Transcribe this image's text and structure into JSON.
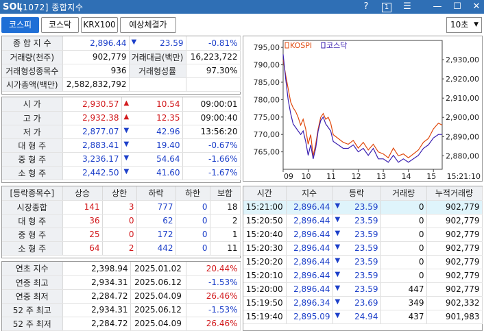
{
  "window": {
    "logo": "SOL",
    "title": "[1072] 종합지수",
    "help": "?",
    "one": "1",
    "menu": "☰",
    "minimize": "—",
    "maximize": "☐",
    "close": "✕"
  },
  "tabs": [
    "코스피",
    "코스닥",
    "KRX100",
    "예상체결가"
  ],
  "interval": "10초",
  "summary": {
    "label_index": "종 합 지 수",
    "index": "2,896.44",
    "change": "23.59",
    "change_pct": "-0.81%",
    "label_volume": "거래량(천주)",
    "volume": "902,779",
    "label_amount": "거래대금(백만)",
    "amount": "16,223,722",
    "label_formed": "거래형성종목수",
    "formed": "936",
    "label_formed_rate": "거래형성률",
    "formed_rate": "97.30%",
    "label_mcap": "시가총액(백만)",
    "mcap": "2,582,832,792"
  },
  "ohlc": [
    {
      "label": "시  가",
      "value": "2,930.57",
      "dir": "up",
      "diff": "10.54",
      "extra": "09:00:01"
    },
    {
      "label": "고  가",
      "value": "2,932.38",
      "dir": "up",
      "diff": "12.35",
      "extra": "09:00:40"
    },
    {
      "label": "저  가",
      "value": "2,877.07",
      "dir": "down",
      "diff": "42.96",
      "extra": "13:56:20"
    },
    {
      "label": "대 형 주",
      "value": "2,883.41",
      "dir": "down",
      "diff": "19.40",
      "extra": "-0.67%"
    },
    {
      "label": "중 형 주",
      "value": "3,236.17",
      "dir": "down",
      "diff": "54.64",
      "extra": "-1.66%"
    },
    {
      "label": "소 형 주",
      "value": "2,442.50",
      "dir": "down",
      "diff": "41.60",
      "extra": "-1.67%"
    }
  ],
  "breadth": {
    "headers": [
      "[등락종목수]",
      "상승",
      "상한",
      "하락",
      "하한",
      "보합"
    ],
    "rows": [
      {
        "label": "시장종합",
        "up": "141",
        "uplimit": "3",
        "down": "777",
        "downlimit": "0",
        "flat": "18"
      },
      {
        "label": "대 형 주",
        "up": "36",
        "uplimit": "0",
        "down": "62",
        "downlimit": "0",
        "flat": "2"
      },
      {
        "label": "중 형 주",
        "up": "25",
        "uplimit": "0",
        "down": "172",
        "downlimit": "0",
        "flat": "1"
      },
      {
        "label": "소 형 주",
        "up": "64",
        "uplimit": "2",
        "down": "442",
        "downlimit": "0",
        "flat": "11"
      }
    ]
  },
  "yearly": [
    {
      "label": "연초  지수",
      "value": "2,398.94",
      "date": "2025.01.02",
      "pct": "20.44%",
      "color": "red"
    },
    {
      "label": "연중  최고",
      "value": "2,934.31",
      "date": "2025.06.12",
      "pct": "-1.53%",
      "color": "blue"
    },
    {
      "label": "연중  최저",
      "value": "2,284.72",
      "date": "2025.04.09",
      "pct": "26.46%",
      "color": "red"
    },
    {
      "label": "52 주 최고",
      "value": "2,934.31",
      "date": "2025.06.12",
      "pct": "-1.53%",
      "color": "blue"
    },
    {
      "label": "52 주 최저",
      "value": "2,284.72",
      "date": "2025.04.09",
      "pct": "26.46%",
      "color": "red"
    }
  ],
  "ticks": {
    "headers": [
      "시간",
      "지수",
      "등락",
      "거래량",
      "누적거래량"
    ],
    "rows": [
      {
        "time": "15:21:00",
        "index": "2,896.44",
        "change": "23.59",
        "vol": "0",
        "cum": "902,779"
      },
      {
        "time": "15:20:50",
        "index": "2,896.44",
        "change": "23.59",
        "vol": "0",
        "cum": "902,779"
      },
      {
        "time": "15:20:40",
        "index": "2,896.44",
        "change": "23.59",
        "vol": "0",
        "cum": "902,779"
      },
      {
        "time": "15:20:30",
        "index": "2,896.44",
        "change": "23.59",
        "vol": "0",
        "cum": "902,779"
      },
      {
        "time": "15:20:20",
        "index": "2,896.44",
        "change": "23.59",
        "vol": "0",
        "cum": "902,779"
      },
      {
        "time": "15:20:10",
        "index": "2,896.44",
        "change": "23.59",
        "vol": "0",
        "cum": "902,779"
      },
      {
        "time": "15:20:00",
        "index": "2,896.44",
        "change": "23.59",
        "vol": "447",
        "cum": "902,779"
      },
      {
        "time": "15:19:50",
        "index": "2,896.34",
        "change": "23.69",
        "vol": "349",
        "cum": "902,332"
      },
      {
        "time": "15:19:40",
        "index": "2,895.09",
        "change": "24.94",
        "vol": "437",
        "cum": "901,983"
      }
    ]
  },
  "colors": {
    "up": "#d2191c",
    "down": "#1c3fc9",
    "kospi": "#e0480c",
    "kosdaq": "#3a1fb0",
    "titlebar": "#2f6fb5",
    "active_tab": "#1f6fd6"
  },
  "chart_data": {
    "type": "line",
    "legend": [
      "KOSPI",
      "코스닥"
    ],
    "legend_placement": "top-left",
    "x_ticks": [
      "09",
      "10",
      "11",
      "12",
      "13",
      "14",
      "15"
    ],
    "x_end_label": "15:21:10",
    "left_axis": {
      "ticks": [
        "795,00",
        "790,00",
        "785,00",
        "780,00",
        "775,00",
        "770,00",
        "765,00"
      ],
      "ylim": [
        760,
        797
      ]
    },
    "right_axis": {
      "ticks": [
        "2,930,00",
        "2,920,00",
        "2,910,00",
        "2,900,00",
        "2,890,00",
        "2,880,00"
      ],
      "ylim": [
        2873,
        2940
      ]
    },
    "series": [
      {
        "name": "KOSPI",
        "axis": "right",
        "x": [
          9.0,
          9.1,
          9.2,
          9.3,
          9.4,
          9.5,
          9.6,
          9.7,
          9.8,
          9.9,
          10.0,
          10.1,
          10.2,
          10.3,
          10.4,
          10.5,
          10.6,
          10.7,
          10.8,
          10.9,
          11.0,
          11.2,
          11.4,
          11.6,
          11.8,
          12.0,
          12.2,
          12.4,
          12.6,
          12.8,
          13.0,
          13.2,
          13.4,
          13.6,
          13.8,
          14.0,
          14.2,
          14.4,
          14.6,
          14.8,
          15.0,
          15.2,
          15.35
        ],
        "y": [
          2930,
          2922,
          2915,
          2908,
          2905,
          2903,
          2900,
          2896,
          2899,
          2894,
          2886,
          2891,
          2880,
          2886,
          2894,
          2900,
          2902,
          2899,
          2900,
          2897,
          2891,
          2889,
          2887,
          2886,
          2888,
          2884,
          2887,
          2883,
          2886,
          2882,
          2881,
          2879,
          2884,
          2880,
          2881,
          2879,
          2881,
          2883,
          2887,
          2889,
          2894,
          2897,
          2896
        ]
      },
      {
        "name": "코스닥",
        "axis": "left",
        "x": [
          9.0,
          9.1,
          9.2,
          9.3,
          9.4,
          9.5,
          9.6,
          9.7,
          9.8,
          9.9,
          10.0,
          10.1,
          10.2,
          10.3,
          10.4,
          10.5,
          10.6,
          10.7,
          10.8,
          10.9,
          11.0,
          11.2,
          11.4,
          11.6,
          11.8,
          12.0,
          12.2,
          12.4,
          12.6,
          12.8,
          13.0,
          13.2,
          13.4,
          13.6,
          13.8,
          14.0,
          14.2,
          14.4,
          14.6,
          14.8,
          15.0,
          15.2,
          15.35
        ],
        "y": [
          793,
          786,
          780,
          776,
          773,
          772,
          771,
          770,
          771,
          768,
          764,
          767,
          763,
          766,
          771,
          774,
          775,
          773,
          772,
          771,
          768,
          767,
          766,
          766,
          767,
          765,
          766,
          764,
          766,
          763,
          763,
          762,
          764,
          762,
          763,
          762,
          763,
          764,
          766,
          767,
          769,
          770,
          770
        ]
      }
    ]
  }
}
